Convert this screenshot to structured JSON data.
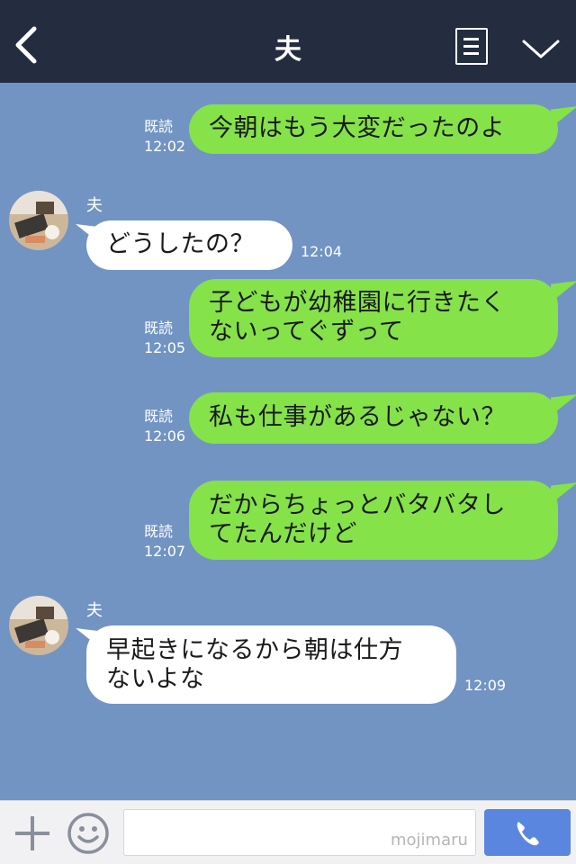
{
  "header": {
    "title": "夫"
  },
  "messages": [
    {
      "type": "sent",
      "read": "既読",
      "time": "12:02",
      "text": "今朝はもう大変だったのよ"
    },
    {
      "type": "received",
      "sender": "夫",
      "time": "12:04",
      "text": "どうしたの？"
    },
    {
      "type": "sent",
      "read": "既読",
      "time": "12:05",
      "text": "子どもが幼稚園に行きたく\nないってぐずって"
    },
    {
      "type": "sent",
      "read": "既読",
      "time": "12:06",
      "text": "私も仕事があるじゃない？"
    },
    {
      "type": "sent",
      "read": "既読",
      "time": "12:07",
      "text": "だからちょっとバタバタし\nてたんだけど"
    },
    {
      "type": "received",
      "sender": "夫",
      "time": "12:09",
      "text": "早起きになるから朝は仕方\nないよな"
    }
  ],
  "footer": {
    "input_value": "",
    "watermark": "mojimaru"
  },
  "colors": {
    "header": "#242c40",
    "background": "#7294c3",
    "sent_bubble": "#85e249",
    "received_bubble": "#ffffff",
    "call_button": "#5b86e0"
  },
  "icons": {
    "back": "chevron-left-icon",
    "menu": "list-icon",
    "collapse": "chevron-down-icon",
    "plus": "plus-icon",
    "emoji": "smiley-icon",
    "call": "phone-icon"
  }
}
